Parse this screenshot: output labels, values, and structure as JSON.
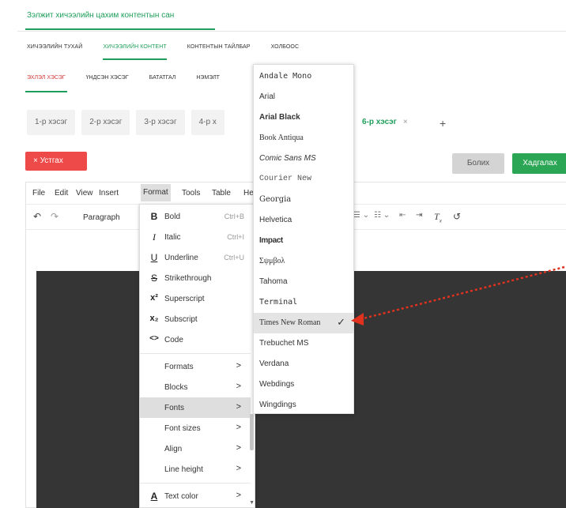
{
  "header": {
    "title": "Зэлжит хичээлийн цахим контентын сан"
  },
  "main_nav": {
    "tabs": [
      {
        "label": "ХИЧЭЭЛИЙН ТУХАЙ",
        "active": false
      },
      {
        "label": "ХИЧЭЭЛИЙН КОНТЕНТ",
        "active": true
      },
      {
        "label": "КОНТЕНТЫН ТАЙЛБАР",
        "active": false
      },
      {
        "label": "ХОЛБООС",
        "active": false
      }
    ]
  },
  "sub_nav": {
    "tabs": [
      {
        "label": "ЭХЛЭЛ ХЭСЭГ",
        "active": true
      },
      {
        "label": "ҮНДСЭН ХЭСЭГ",
        "active": false
      },
      {
        "label": "БАТАТГАЛ",
        "active": false
      },
      {
        "label": "НЭМЭЛТ",
        "active": false
      }
    ]
  },
  "sections": {
    "tabs": [
      {
        "label": "1-р хэсэг"
      },
      {
        "label": "2-р хэсэг"
      },
      {
        "label": "3-р хэсэг"
      },
      {
        "label": "4-р х"
      },
      {
        "label": "6-р хэсэг",
        "close": "×",
        "active": true
      }
    ],
    "add": "+"
  },
  "actions": {
    "delete": "× Устгах",
    "cancel": "Болих",
    "save": "Хадгалах"
  },
  "editor": {
    "menubar": [
      "File",
      "Edit",
      "View",
      "Insert",
      "Format",
      "Tools",
      "Table",
      "He"
    ],
    "menubar_active": "Format",
    "toolbar": {
      "paragraph": "Paragraph"
    }
  },
  "format_menu": {
    "items": [
      {
        "icon": "B",
        "label": "Bold",
        "shortcut": "Ctrl+B"
      },
      {
        "icon": "I",
        "label": "Italic",
        "shortcut": "Ctrl+I"
      },
      {
        "icon": "U",
        "label": "Underline",
        "shortcut": "Ctrl+U"
      },
      {
        "icon": "S",
        "label": "Strikethrough",
        "shortcut": ""
      },
      {
        "icon": "x²",
        "label": "Superscript",
        "shortcut": ""
      },
      {
        "icon": "x₂",
        "label": "Subscript",
        "shortcut": ""
      },
      {
        "icon": "<>",
        "label": "Code",
        "shortcut": ""
      }
    ],
    "submenus": [
      {
        "label": "Formats",
        "arrow": ">"
      },
      {
        "label": "Blocks",
        "arrow": ">"
      },
      {
        "label": "Fonts",
        "arrow": ">",
        "active": true
      },
      {
        "label": "Font sizes",
        "arrow": ">"
      },
      {
        "label": "Align",
        "arrow": ">"
      },
      {
        "label": "Line height",
        "arrow": ">"
      }
    ],
    "text_color": {
      "icon": "A",
      "label": "Text color",
      "arrow": ">"
    }
  },
  "fonts_menu": {
    "items": [
      {
        "label": "Andale Mono"
      },
      {
        "label": "Arial"
      },
      {
        "label": "Arial Black"
      },
      {
        "label": "Book Antiqua"
      },
      {
        "label": "Comic Sans MS"
      },
      {
        "label": "Courier New"
      },
      {
        "label": "Georgia"
      },
      {
        "label": "Helvetica"
      },
      {
        "label": "Impact"
      },
      {
        "label": "Σψμβολ"
      },
      {
        "label": "Tahoma"
      },
      {
        "label": "Terminal"
      },
      {
        "label": "Times New Roman",
        "selected": true,
        "check": "✓"
      },
      {
        "label": "Trebuchet MS"
      },
      {
        "label": "Verdana"
      },
      {
        "label": "Webdings"
      },
      {
        "label": "Wingdings"
      }
    ]
  },
  "colors": {
    "brand_green": "#1e9e5a",
    "delete_red": "#ef4a4a",
    "annotation_red": "#e0321e"
  }
}
